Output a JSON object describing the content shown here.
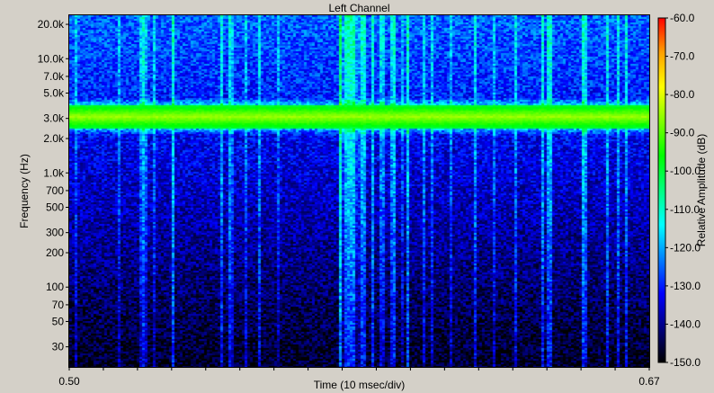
{
  "chart_data": {
    "type": "heatmap",
    "title": "Left Channel",
    "xlabel": "Time (10 msec/div)",
    "ylabel": "Frequency (Hz)",
    "xlim": [
      0.5,
      0.67
    ],
    "x_tick_labels": [
      {
        "value": 0.5,
        "label": "0.50"
      },
      {
        "value": 0.67,
        "label": "0.67"
      }
    ],
    "x_minor_tick_step": 0.01,
    "y_scale": "log",
    "ylim": [
      20,
      24000
    ],
    "y_tick_labels": [
      {
        "value": 30,
        "label": "30"
      },
      {
        "value": 50,
        "label": "50"
      },
      {
        "value": 70,
        "label": "70"
      },
      {
        "value": 100,
        "label": "100"
      },
      {
        "value": 200,
        "label": "200"
      },
      {
        "value": 300,
        "label": "300"
      },
      {
        "value": 500,
        "label": "500"
      },
      {
        "value": 700,
        "label": "700"
      },
      {
        "value": 1000,
        "label": "1.0k"
      },
      {
        "value": 2000,
        "label": "2.0k"
      },
      {
        "value": 3000,
        "label": "3.0k"
      },
      {
        "value": 5000,
        "label": "5.0k"
      },
      {
        "value": 7000,
        "label": "7.0k"
      },
      {
        "value": 10000,
        "label": "10.0k"
      },
      {
        "value": 20000,
        "label": "20.0k"
      }
    ],
    "colorbar": {
      "label": "Relative Amplitude (dB)",
      "range": [
        -150,
        -60
      ],
      "ticks": [
        {
          "value": -60,
          "label": "-60.0"
        },
        {
          "value": -70,
          "label": "-70.0"
        },
        {
          "value": -80,
          "label": "-80.0"
        },
        {
          "value": -90,
          "label": "-90.0"
        },
        {
          "value": -100,
          "label": "-100.0"
        },
        {
          "value": -110,
          "label": "-110.0"
        },
        {
          "value": -120,
          "label": "-120.0"
        },
        {
          "value": -130,
          "label": "-130.0"
        },
        {
          "value": -140,
          "label": "-140.0"
        },
        {
          "value": -150,
          "label": "-150.0"
        }
      ],
      "colors": [
        "#000000",
        "#000080",
        "#0000ff",
        "#0080ff",
        "#00ffff",
        "#00ff80",
        "#00ff00",
        "#80ff00",
        "#ffff00",
        "#ffa000",
        "#ff0000"
      ]
    },
    "features": {
      "tone_band_hz": [
        2500,
        4000
      ],
      "tone_band_level_db": [
        -100,
        -85
      ],
      "background_level_db": [
        -150,
        -125
      ],
      "transient_time": 0.582
    },
    "grid": false
  }
}
